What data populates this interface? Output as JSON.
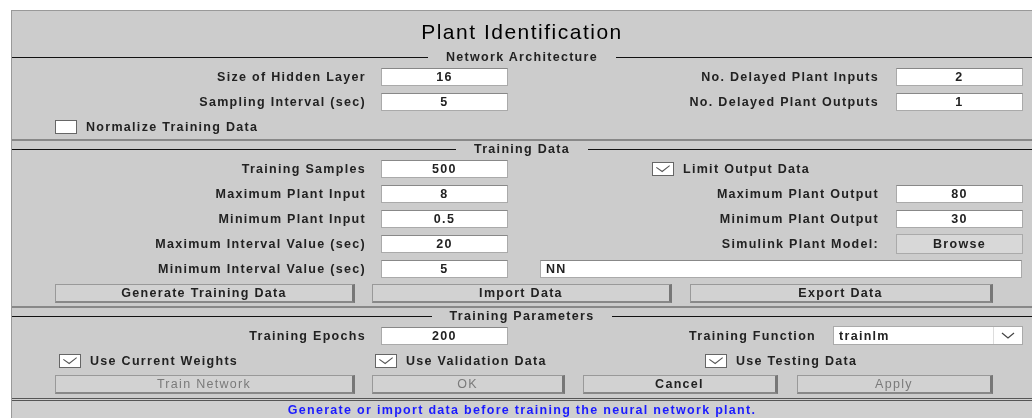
{
  "title": "Plant Identification",
  "sections": [
    {
      "title": "Network Architecture",
      "rows": [
        {
          "cells": [
            {
              "kind": "field",
              "label": "Size of Hidden Layer",
              "value": "16"
            },
            {
              "kind": "field",
              "label": "No. Delayed Plant Inputs",
              "value": "2"
            }
          ]
        },
        {
          "cells": [
            {
              "kind": "field",
              "label": "Sampling Interval (sec)",
              "value": "5"
            },
            {
              "kind": "field",
              "label": "No. Delayed Plant Outputs",
              "value": "1"
            }
          ]
        },
        {
          "cells": [
            {
              "kind": "checkbox",
              "label": "Normalize Training Data",
              "checked": false
            }
          ]
        }
      ]
    },
    {
      "title": "Training Data",
      "rows": [
        {
          "cells": [
            {
              "kind": "field",
              "label": "Training Samples",
              "value": "500"
            },
            {
              "kind": "checkbox",
              "label": "Limit Output Data",
              "checked": true
            }
          ]
        },
        {
          "cells": [
            {
              "kind": "field",
              "label": "Maximum Plant Input",
              "value": "8"
            },
            {
              "kind": "field",
              "label": "Maximum Plant Output",
              "value": "80"
            }
          ]
        },
        {
          "cells": [
            {
              "kind": "field",
              "label": "Minimum Plant Input",
              "value": "0.5"
            },
            {
              "kind": "field",
              "label": "Minimum Plant Output",
              "value": "30"
            }
          ]
        },
        {
          "cells": [
            {
              "kind": "field",
              "label": "Maximum Interval Value (sec)",
              "value": "20"
            },
            {
              "kind": "browse",
              "label": "Simulink Plant Model:",
              "button": "Browse"
            }
          ]
        },
        {
          "cells": [
            {
              "kind": "field",
              "label": "Minimum Interval Value (sec)",
              "value": "5"
            },
            {
              "kind": "wide",
              "value": "NN"
            }
          ]
        },
        {
          "cells": [
            {
              "kind": "button",
              "label": "Generate Training Data",
              "disabled": false
            },
            {
              "kind": "button",
              "label": "Import Data",
              "disabled": false
            },
            {
              "kind": "button",
              "label": "Export Data",
              "disabled": false
            }
          ]
        }
      ]
    },
    {
      "title": "Training Parameters",
      "rows": [
        {
          "cells": [
            {
              "kind": "field",
              "label": "Training Epochs",
              "value": "200"
            },
            {
              "kind": "dropdown",
              "label": "Training Function",
              "value": "trainlm"
            }
          ]
        },
        {
          "cells": [
            {
              "kind": "checkbox",
              "label": "Use Current Weights",
              "checked": true
            },
            {
              "kind": "checkbox",
              "label": "Use Validation Data",
              "checked": true
            },
            {
              "kind": "checkbox",
              "label": "Use Testing Data",
              "checked": true
            }
          ]
        },
        {
          "cells": [
            {
              "kind": "button",
              "label": "Train Network",
              "disabled": true
            },
            {
              "kind": "button",
              "label": "OK",
              "disabled": true
            },
            {
              "kind": "button",
              "label": "Cancel",
              "disabled": false
            },
            {
              "kind": "button",
              "label": "Apply",
              "disabled": true
            }
          ]
        }
      ]
    }
  ],
  "status": "Generate or import data before training the neural network plant."
}
